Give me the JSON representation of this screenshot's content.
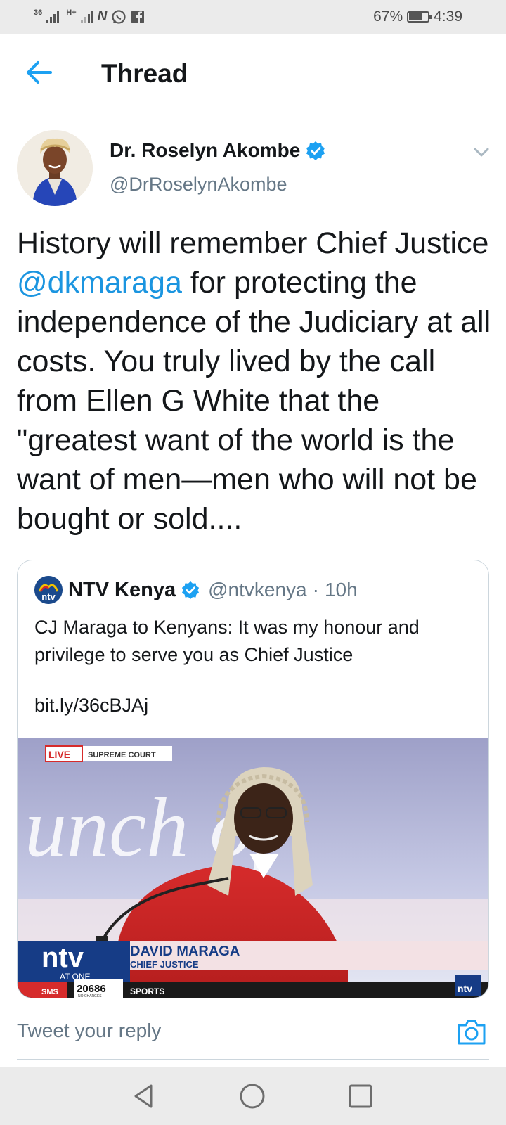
{
  "status_bar": {
    "net1": "36",
    "net2": "H+",
    "battery_percent": "67%",
    "battery_level": 0.67,
    "time": "4:39",
    "icons": [
      "signal-icon",
      "signal-icon",
      "n-app-icon",
      "whatsapp-icon",
      "facebook-icon",
      "battery-icon"
    ]
  },
  "header": {
    "title": "Thread",
    "back_icon": "arrow-left-icon"
  },
  "tweet": {
    "author_name": "Dr. Roselyn Akombe",
    "handle": "@DrRoselynAkombe",
    "verified": true,
    "text_before": "History will remember Chief Justice ",
    "mention": "@dkmaraga",
    "text_after": " for protecting the independence of the Judiciary at all costs. You truly lived by the call from Ellen G White that the \"greatest want of the world is the want of men—men who will not be bought or sold...."
  },
  "quote": {
    "author_name": "NTV Kenya",
    "handle": "@ntvkenya",
    "separator": "·",
    "time": "10h",
    "text": "CJ Maraga to Kenyans: It was my honour and privilege to serve you as Chief Justice",
    "link": "bit.ly/36cBJAj",
    "media": {
      "live_label": "LIVE",
      "location_label": "SUPREME COURT",
      "logo_text": "ntv",
      "logo_sub": "AT ONE",
      "person_name": "DAVID MARAGA",
      "person_title": "CHIEF JUSTICE",
      "sms_label": "SMS",
      "sms_number": "20686",
      "sms_note": "NO CHARGES",
      "ticker": "SPORTS",
      "corner_logo": "ntv",
      "backdrop_text": "unch of"
    }
  },
  "reply": {
    "placeholder": "Tweet your reply",
    "camera_icon": "camera-icon"
  },
  "colors": {
    "accent": "#1da1f2",
    "link": "#1b95e0",
    "text": "#14171a",
    "secondary": "#657786",
    "status_bg": "#ebebeb"
  }
}
